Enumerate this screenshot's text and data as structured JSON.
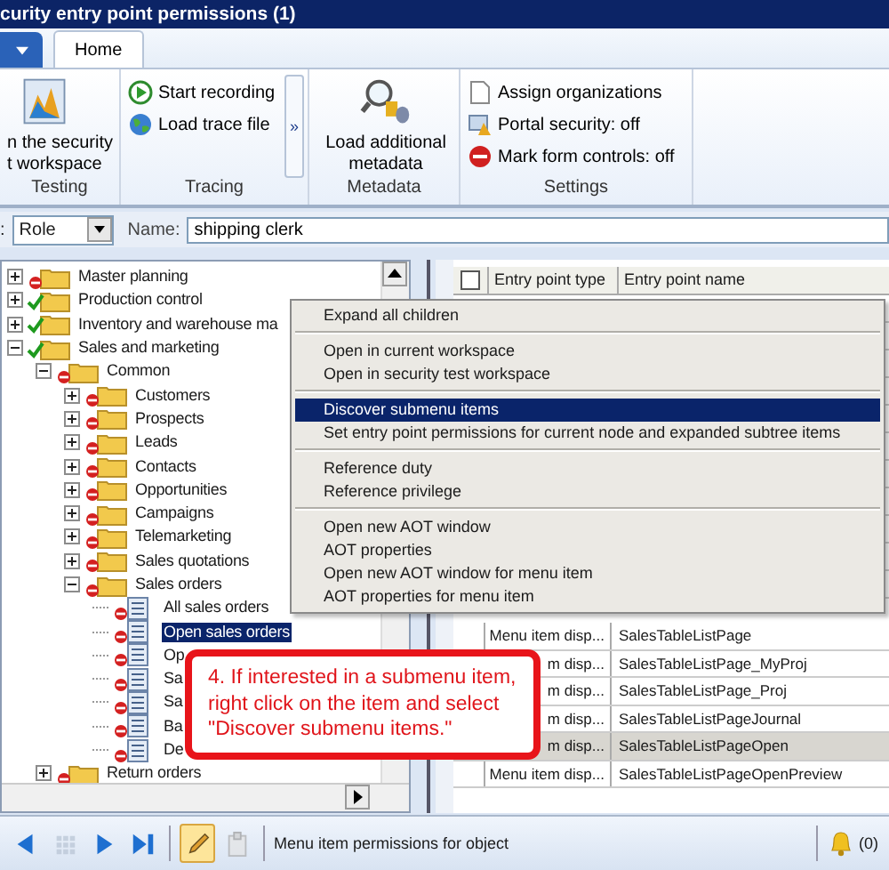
{
  "window": {
    "title": "curity entry point permissions (1)"
  },
  "ribbon": {
    "tabs": [
      {
        "label": "Home",
        "selected": true
      }
    ],
    "groups": [
      {
        "label": "Testing",
        "kind": "large",
        "buttons": [
          {
            "lines": [
              "n the security",
              "t workspace"
            ]
          }
        ]
      },
      {
        "label": "Tracing",
        "kind": "small",
        "more": "»",
        "buttons": [
          {
            "lines": [
              "Start recording"
            ]
          },
          {
            "lines": [
              "Load trace file"
            ]
          }
        ]
      },
      {
        "label": "Metadata",
        "kind": "large",
        "buttons": [
          {
            "lines": [
              "Load additional",
              "metadata"
            ]
          }
        ]
      },
      {
        "label": "Settings",
        "kind": "small",
        "buttons": [
          {
            "lines": [
              "Assign organizations"
            ]
          },
          {
            "lines": [
              "Portal security: off"
            ]
          },
          {
            "lines": [
              "Mark form controls: off"
            ]
          }
        ]
      }
    ]
  },
  "filter": {
    "type_label": ":",
    "type_value": "Role",
    "name_label": "Name:",
    "name_value": "shipping clerk"
  },
  "tree": [
    {
      "label": "Master planning",
      "kind": "folder",
      "granted": false,
      "expanded": false,
      "selected": false
    },
    {
      "label": "Production control",
      "kind": "folder",
      "granted": true,
      "expanded": false,
      "selected": false
    },
    {
      "label": "Inventory and warehouse ma",
      "kind": "folder",
      "granted": true,
      "expanded": false,
      "selected": false
    },
    {
      "label": "Sales and marketing",
      "kind": "folder",
      "granted": true,
      "expanded": true,
      "selected": false,
      "children": [
        {
          "label": "Common",
          "kind": "folder",
          "granted": false,
          "expanded": true,
          "selected": false,
          "children": [
            {
              "label": "Customers",
              "kind": "folder",
              "granted": false,
              "expanded": false,
              "selected": false
            },
            {
              "label": "Prospects",
              "kind": "folder",
              "granted": false,
              "expanded": false,
              "selected": false
            },
            {
              "label": "Leads",
              "kind": "folder",
              "granted": false,
              "expanded": false,
              "selected": false
            },
            {
              "label": "Contacts",
              "kind": "folder",
              "granted": false,
              "expanded": false,
              "selected": false
            },
            {
              "label": "Opportunities",
              "kind": "folder",
              "granted": false,
              "expanded": false,
              "selected": false
            },
            {
              "label": "Campaigns",
              "kind": "folder",
              "granted": false,
              "expanded": false,
              "selected": false
            },
            {
              "label": "Telemarketing",
              "kind": "folder",
              "granted": false,
              "expanded": false,
              "selected": false
            },
            {
              "label": "Sales quotations",
              "kind": "folder",
              "granted": false,
              "expanded": false,
              "selected": false
            },
            {
              "label": "Sales orders",
              "kind": "folder",
              "granted": false,
              "expanded": true,
              "selected": false,
              "children": [
                {
                  "label": "All sales orders",
                  "kind": "menu_item",
                  "granted": false,
                  "selected": false
                },
                {
                  "label": "Open sales orders",
                  "kind": "menu_item",
                  "granted": false,
                  "selected": true
                },
                {
                  "label": "Op",
                  "kind": "menu_item",
                  "granted": false,
                  "selected": false
                },
                {
                  "label": "Sa",
                  "kind": "menu_item",
                  "granted": false,
                  "selected": false
                },
                {
                  "label": "Sa",
                  "kind": "menu_item",
                  "granted": false,
                  "selected": false
                },
                {
                  "label": "Ba",
                  "kind": "menu_item",
                  "granted": false,
                  "selected": false
                },
                {
                  "label": "De",
                  "kind": "menu_item",
                  "granted": false,
                  "selected": false
                }
              ]
            }
          ]
        },
        {
          "label": "Return orders",
          "kind": "folder",
          "granted": false,
          "expanded": false,
          "selected": false
        }
      ]
    }
  ],
  "grid": {
    "select_all": false,
    "columns": [
      "Entry point type",
      "Entry point name"
    ],
    "rows": [
      {
        "type": "Menu item disp...",
        "name": "SalesTableListPage",
        "selected": false
      },
      {
        "type": "m disp...",
        "name": "SalesTableListPage_MyProj",
        "selected": false
      },
      {
        "type": "m disp...",
        "name": "SalesTableListPage_Proj",
        "selected": false
      },
      {
        "type": "m disp...",
        "name": "SalesTableListPageJournal",
        "selected": false
      },
      {
        "type": "m disp...",
        "name": "SalesTableListPageOpen",
        "selected": true
      },
      {
        "type": "Menu item disp...",
        "name": "SalesTableListPageOpenPreview",
        "selected": false
      }
    ]
  },
  "context_menu": {
    "groups": [
      {
        "items": [
          {
            "label": "Expand all children",
            "selected": false
          }
        ]
      },
      {
        "items": [
          {
            "label": "Open in current workspace",
            "selected": false
          },
          {
            "label": "Open in security test workspace",
            "selected": false
          }
        ]
      },
      {
        "items": [
          {
            "label": "Discover submenu items",
            "selected": true
          },
          {
            "label": "Set entry point permissions for current node and expanded subtree items",
            "selected": false
          }
        ]
      },
      {
        "items": [
          {
            "label": "Reference duty",
            "selected": false
          },
          {
            "label": "Reference privilege",
            "selected": false
          }
        ]
      },
      {
        "items": [
          {
            "label": "Open new AOT window",
            "selected": false
          },
          {
            "label": "AOT properties",
            "selected": false
          },
          {
            "label": "Open new AOT window for menu item",
            "selected": false
          },
          {
            "label": "AOT properties for menu item",
            "selected": false
          }
        ]
      }
    ]
  },
  "callout": {
    "text": "4. If interested in a submenu item, right click on the item and select \"Discover submenu items.\""
  },
  "status_bar": {
    "tools": [
      {
        "kind": "previous",
        "on": false,
        "disabled": false
      },
      {
        "kind": "grid",
        "on": false,
        "disabled": true
      },
      {
        "kind": "next",
        "on": false,
        "disabled": false
      },
      {
        "kind": "last",
        "on": false,
        "disabled": false
      },
      {
        "kind": "edit",
        "on": true,
        "disabled": false
      },
      {
        "kind": "paste",
        "on": false,
        "disabled": true
      }
    ],
    "text": "Menu item permissions for object",
    "alerts": "(0)"
  }
}
